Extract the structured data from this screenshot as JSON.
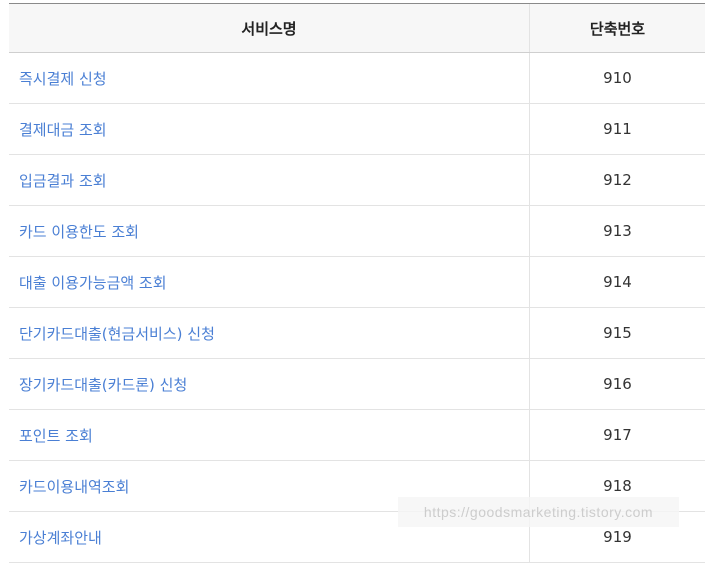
{
  "table": {
    "headers": {
      "service_name": "서비스명",
      "shortcut_number": "단축번호"
    },
    "rows": [
      {
        "name": "즉시결제 신청",
        "code": "910"
      },
      {
        "name": "결제대금 조회",
        "code": "911"
      },
      {
        "name": "입금결과 조회",
        "code": "912"
      },
      {
        "name": "카드 이용한도 조회",
        "code": "913"
      },
      {
        "name": "대출 이용가능금액 조회",
        "code": "914"
      },
      {
        "name": "단기카드대출(현금서비스) 신청",
        "code": "915"
      },
      {
        "name": "장기카드대출(카드론) 신청",
        "code": "916"
      },
      {
        "name": "포인트 조회",
        "code": "917"
      },
      {
        "name": "카드이용내역조회",
        "code": "918"
      },
      {
        "name": "가상계좌안내",
        "code": "919"
      }
    ]
  },
  "watermark": {
    "text": "https://goodsmarketing.tistory.com"
  },
  "colors": {
    "link": "#4a7fd4",
    "header_bg": "#f7f7f7",
    "border": "#e3e3e3"
  }
}
